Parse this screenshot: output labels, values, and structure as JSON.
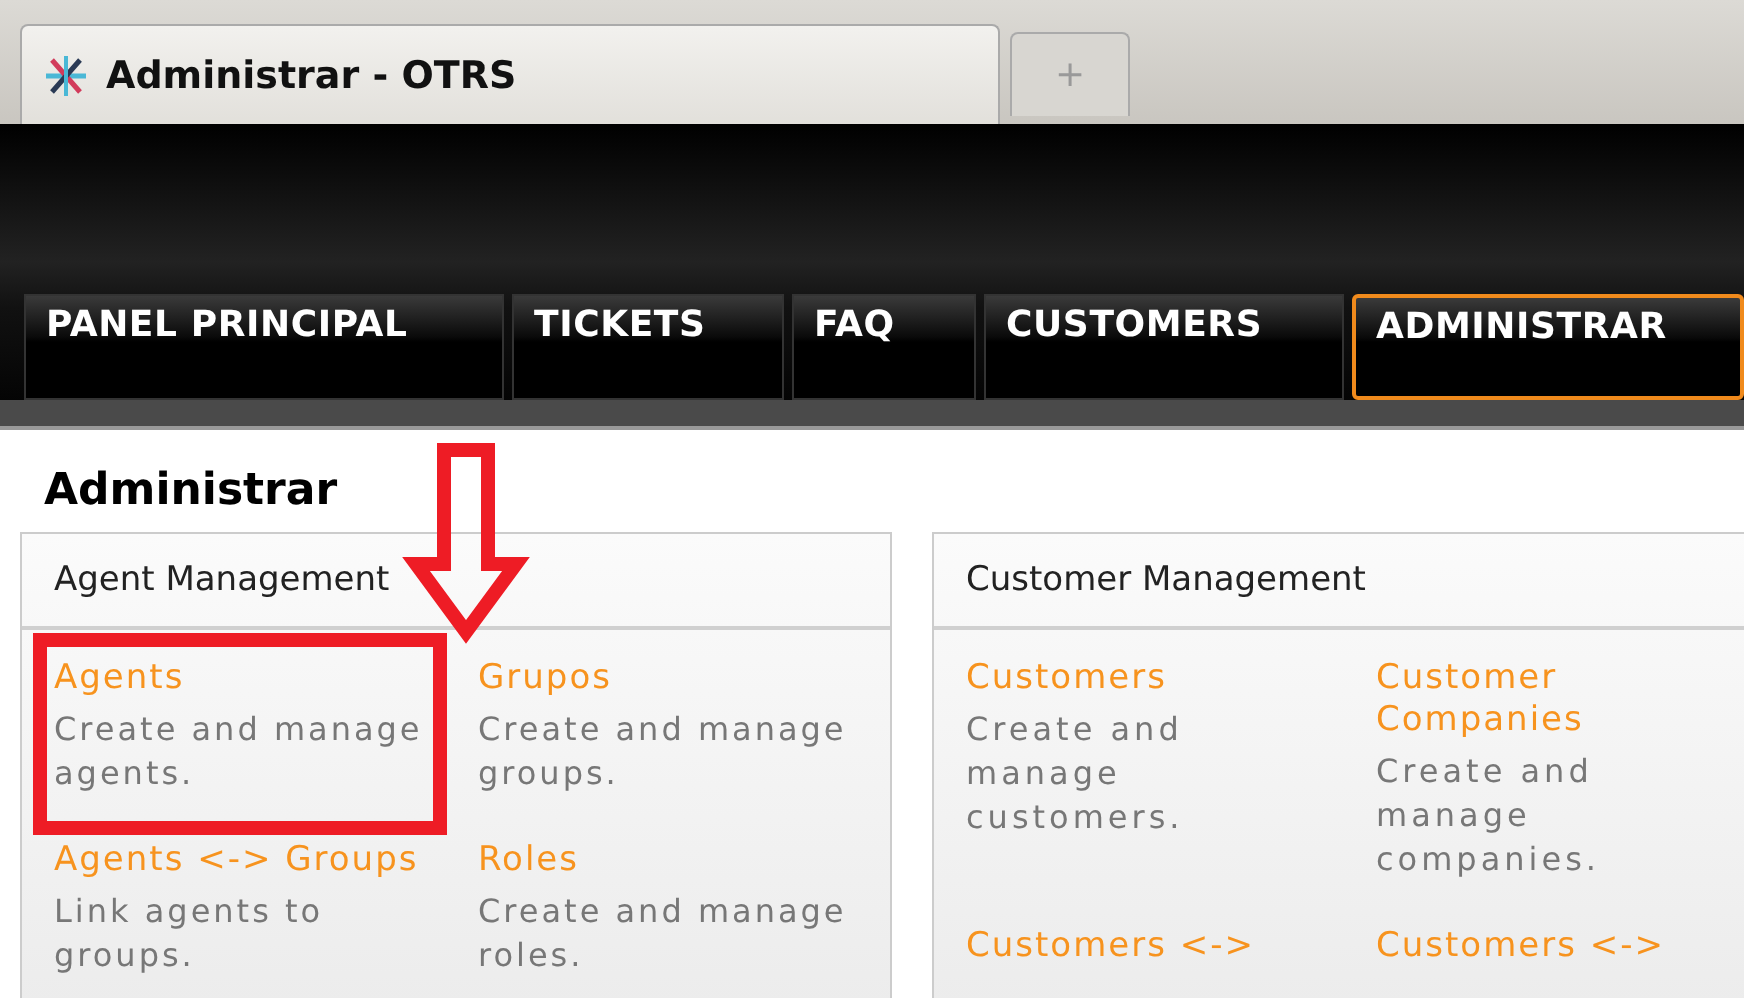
{
  "browser_tabs": [
    {
      "title": "Administrar - OTRS",
      "selected": true
    },
    {
      "title": "+",
      "selected": false
    }
  ],
  "nav": [
    {
      "label": "PANEL PRINCIPAL",
      "selected": false
    },
    {
      "label": "TICKETS",
      "selected": false
    },
    {
      "label": "FAQ",
      "selected": false
    },
    {
      "label": "CUSTOMERS",
      "selected": false
    },
    {
      "label": "ADMINISTRAR",
      "selected": true
    }
  ],
  "page_title": "Administrar",
  "panels": [
    {
      "title": "Agent Management",
      "items": [
        {
          "link": "Agents",
          "description": "Create and manage agents."
        },
        {
          "link": "Grupos",
          "description": "Create and manage groups."
        },
        {
          "link": "Agents <-> Groups",
          "description": "Link agents to groups."
        },
        {
          "link": "Roles",
          "description": "Create and manage roles."
        }
      ]
    },
    {
      "title": "Customer Management",
      "items": [
        {
          "link": "Customers",
          "description": "Create and manage customers."
        },
        {
          "link": "Customer Companies",
          "description": "Create and manage companies."
        },
        {
          "link": "Customers <->"
        },
        {
          "link": "Customers <->"
        }
      ]
    }
  ]
}
